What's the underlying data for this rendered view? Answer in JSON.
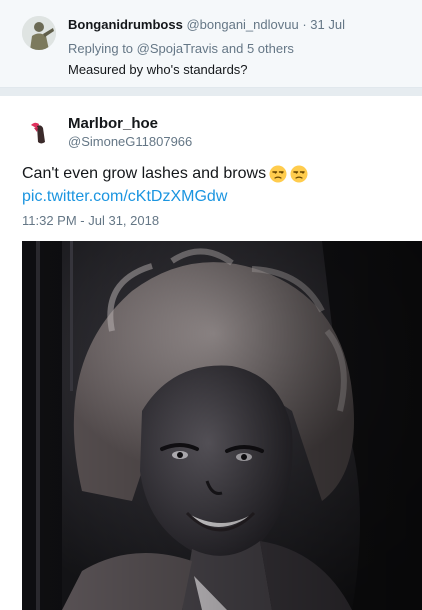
{
  "reply_tweet": {
    "display_name": "Bonganidrumboss",
    "handle": "@bongani_ndlovuu",
    "separator": "·",
    "date": "31 Jul",
    "replying_prefix": "Replying to",
    "replying_user": "@SpojaTravis",
    "replying_suffix": "and 5 others",
    "text": "Measured by who's standards?"
  },
  "main_tweet": {
    "display_name": "Marlbor_hoe",
    "handle": "@SimoneG11807966",
    "text": "Can't even grow lashes and brows",
    "emojis": [
      "unamused-face-icon",
      "unamused-face-icon"
    ],
    "link": "pic.twitter.com/cKtDzXMGdw",
    "timestamp": "11:32 PM - Jul 31, 2018"
  },
  "colors": {
    "link": "#1b95e0",
    "secondary_text": "#657786",
    "primary_text": "#14171a",
    "emoji": "#ffcc4d"
  }
}
